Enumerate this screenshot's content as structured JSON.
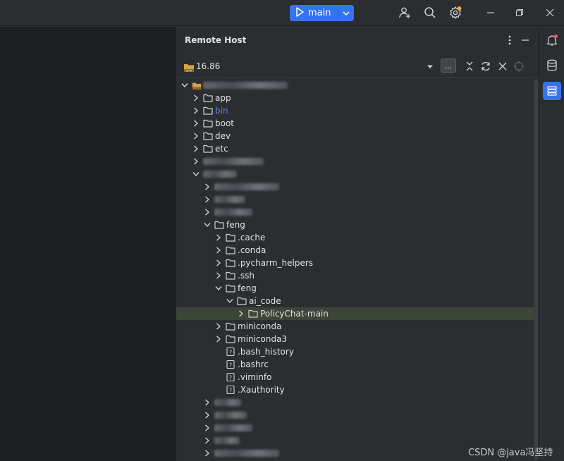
{
  "toolbar": {
    "run_config_label": "main",
    "icons": [
      "play-icon",
      "chevron-down-icon",
      "add-user-icon",
      "search-icon",
      "settings-icon"
    ]
  },
  "window": {
    "icons": [
      "minimize-icon",
      "restore-icon",
      "close-icon"
    ]
  },
  "panel": {
    "title": "Remote Host",
    "host": "16.86",
    "browse_label": "..."
  },
  "tree": {
    "rows": [
      {
        "label": "",
        "blurred": true,
        "expanded": true
      },
      {
        "label": "app",
        "type": "folder"
      },
      {
        "label": "bin",
        "type": "folder",
        "color": "#548af7"
      },
      {
        "label": "boot",
        "type": "folder"
      },
      {
        "label": "dev",
        "type": "folder"
      },
      {
        "label": "etc",
        "type": "folder"
      },
      {
        "label": "",
        "blurred": true
      },
      {
        "label": "",
        "blurred": true,
        "expanded": true
      },
      {
        "label": "",
        "blurred": true
      },
      {
        "label": "",
        "blurred": true
      },
      {
        "label": "",
        "blurred": true
      },
      {
        "label": "feng",
        "type": "folder",
        "expanded": true
      },
      {
        "label": ".cache",
        "type": "folder"
      },
      {
        "label": ".conda",
        "type": "folder"
      },
      {
        "label": ".pycharm_helpers",
        "type": "folder"
      },
      {
        "label": ".ssh",
        "type": "folder"
      },
      {
        "label": "feng",
        "type": "folder",
        "expanded": true
      },
      {
        "label": "ai_code",
        "type": "folder",
        "expanded": true
      },
      {
        "label": "PolicyChat-main",
        "type": "folder",
        "selected": true
      },
      {
        "label": "miniconda",
        "type": "folder"
      },
      {
        "label": "miniconda3",
        "type": "folder"
      },
      {
        "label": ".bash_history",
        "type": "file"
      },
      {
        "label": ".bashrc",
        "type": "file"
      },
      {
        "label": ".viminfo",
        "type": "file"
      },
      {
        "label": ".Xauthority",
        "type": "file"
      },
      {
        "label": "",
        "blurred": true
      },
      {
        "label": "",
        "blurred": true
      },
      {
        "label": "",
        "blurred": true
      },
      {
        "label": "",
        "blurred": true
      },
      {
        "label": "",
        "blurred": true
      }
    ]
  },
  "rightbar": {
    "icons": [
      "notifications-icon",
      "database-icon",
      "remote-host-icon"
    ]
  },
  "watermark": "CSDN @java冯坚持",
  "colors": {
    "accent": "#3574f0",
    "selection": "#3d4438",
    "notification_dot": "#e55b4d",
    "settings_dot": "#f2a33a"
  }
}
